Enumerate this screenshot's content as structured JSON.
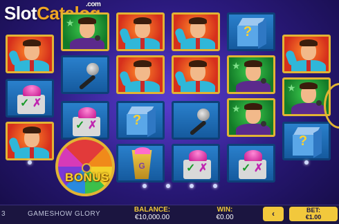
{
  "watermark": {
    "part1": "Slot",
    "part2": "Catalog",
    "suffix": ".com"
  },
  "bonus_label": "BONUS",
  "bottom_bar": {
    "partial_left": "3",
    "game_title": "GAMESHOW GLORY",
    "balance_label": "BALANCE:",
    "balance_value": "€10,000.00",
    "win_label": "WIN:",
    "win_value": "€0.00",
    "back_button": "‹",
    "bet_label": "BET:",
    "bet_value": "€1.00"
  },
  "reels": [
    [
      "host-cyan-red",
      "host-cyan-red",
      "bonus-wheel"
    ],
    [
      "host-purple-green",
      "button-check-cross",
      "button-check-cross"
    ],
    [
      "host-purple-green",
      "host-cyan-red",
      "mystery-box",
      "pedestal"
    ],
    [
      "host-cyan-red",
      "host-cyan-red",
      "mystery-box",
      "button-check-cross"
    ],
    [
      "mystery-box",
      "host-purple-green",
      "microphone",
      "button-check-cross"
    ],
    [
      "mystery-box",
      "host-purple-green",
      "host-purple-green",
      "button-check-cross"
    ],
    [
      "host-cyan-red",
      "host-purple-green",
      "mystery-box"
    ]
  ],
  "colors": {
    "accent_gold": "#e2b434",
    "bg_purple": "#2b1a7e",
    "bar": "#1b1540"
  }
}
